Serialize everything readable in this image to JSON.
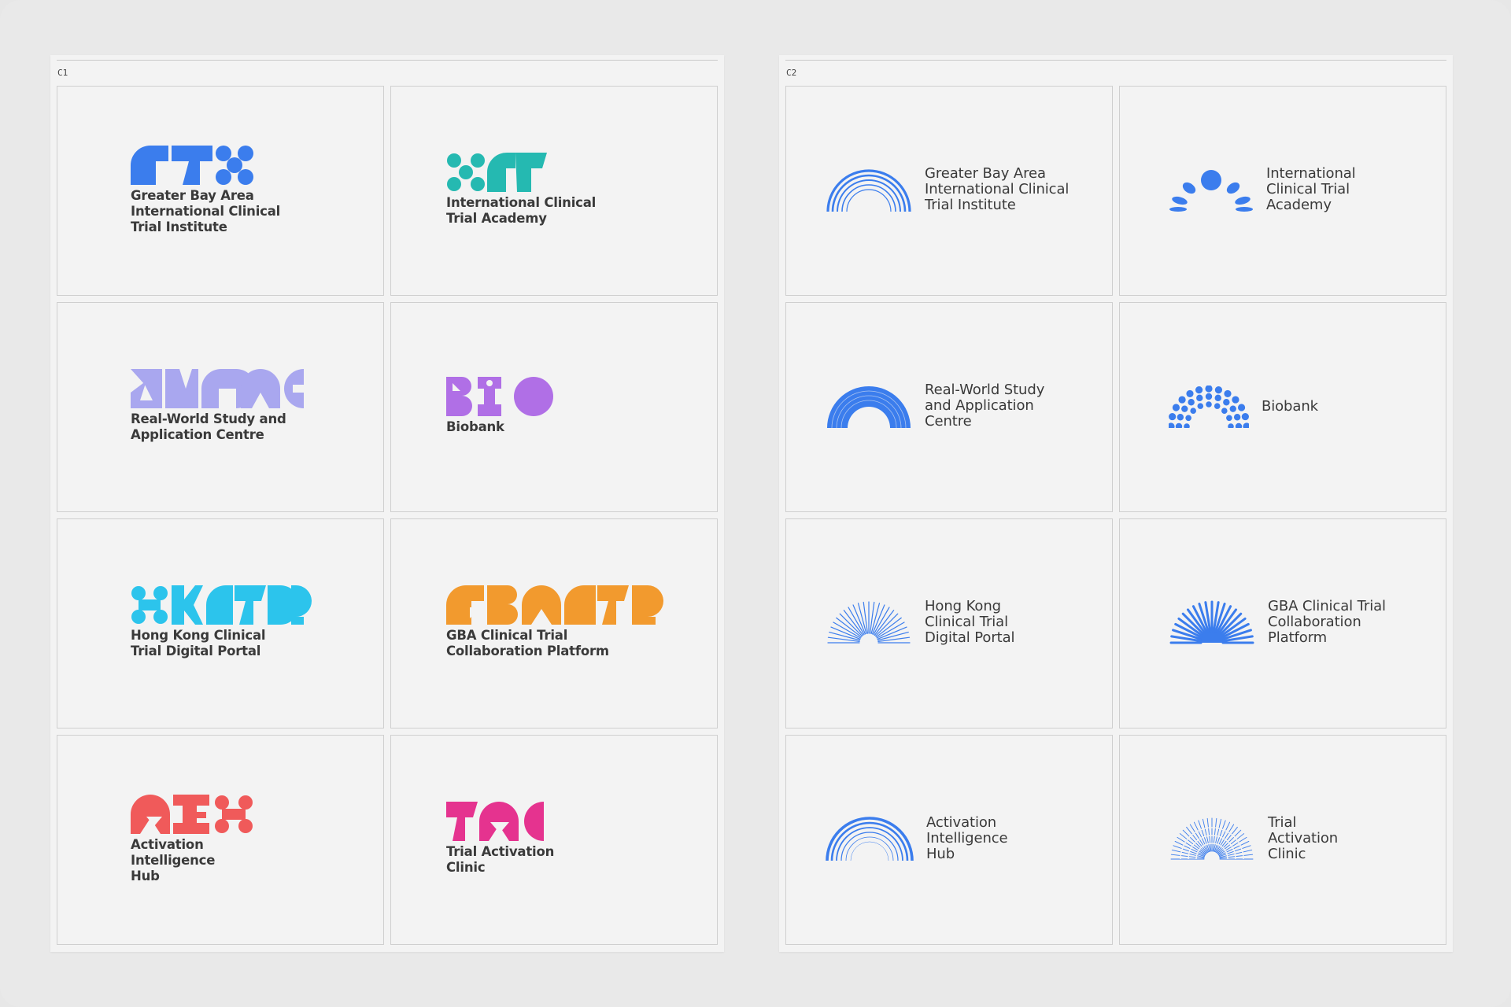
{
  "panels": [
    {
      "label": "C1",
      "cards": [
        {
          "name": "Greater Bay Area\nInternational Clinical\nTrial Institute",
          "color": "#3b7ded",
          "icon": "gbai-wordmark-icon"
        },
        {
          "name": "International Clinical\nTrial Academy",
          "color": "#25b9b1",
          "icon": "ict-wordmark-icon"
        },
        {
          "name": "Real-World Study and\nApplication Centre",
          "color": "#a9a7ef",
          "icon": "rwsac-wordmark-icon"
        },
        {
          "name": "Biobank",
          "color": "#b06fe6",
          "icon": "bio-wordmark-icon"
        },
        {
          "name": "Hong Kong Clinical\nTrial Digital Portal",
          "color": "#2cc4ec",
          "icon": "hkctdp-wordmark-icon"
        },
        {
          "name": "GBA Clinical Trial\nCollaboration Platform",
          "color": "#f29a2e",
          "icon": "gbactcp-wordmark-icon"
        },
        {
          "name": "Activation\nIntelligence\nHub",
          "color": "#f05a5a",
          "icon": "aih-wordmark-icon"
        },
        {
          "name": "Trial Activation\nClinic",
          "color": "#e5338f",
          "icon": "tac-wordmark-icon"
        }
      ]
    },
    {
      "label": "C2",
      "cards": [
        {
          "name": "Greater Bay Area\nInternational Clinical\nTrial Institute",
          "color": "#3b7ded",
          "icon": "concentric-arcs-icon"
        },
        {
          "name": "International\nClinical Trial\nAcademy",
          "color": "#3b7ded",
          "icon": "rising-sun-petals-icon"
        },
        {
          "name": "Real-World Study\nand Application\nCentre",
          "color": "#3b7ded",
          "icon": "dense-arc-icon"
        },
        {
          "name": "Biobank",
          "color": "#3b7ded",
          "icon": "dotted-arcs-icon"
        },
        {
          "name": "Hong Kong\nClinical Trial\nDigital Portal",
          "color": "#3b7ded",
          "icon": "thin-sunburst-icon"
        },
        {
          "name": "GBA Clinical Trial\nCollaboration\nPlatform",
          "color": "#3b7ded",
          "icon": "bold-sunburst-icon"
        },
        {
          "name": "Activation\nIntelligence\nHub",
          "color": "#3b7ded",
          "icon": "fading-arcs-icon"
        },
        {
          "name": "Trial\nActivation\nClinic",
          "color": "#3b7ded",
          "icon": "dashed-sunburst-icon"
        }
      ]
    }
  ]
}
